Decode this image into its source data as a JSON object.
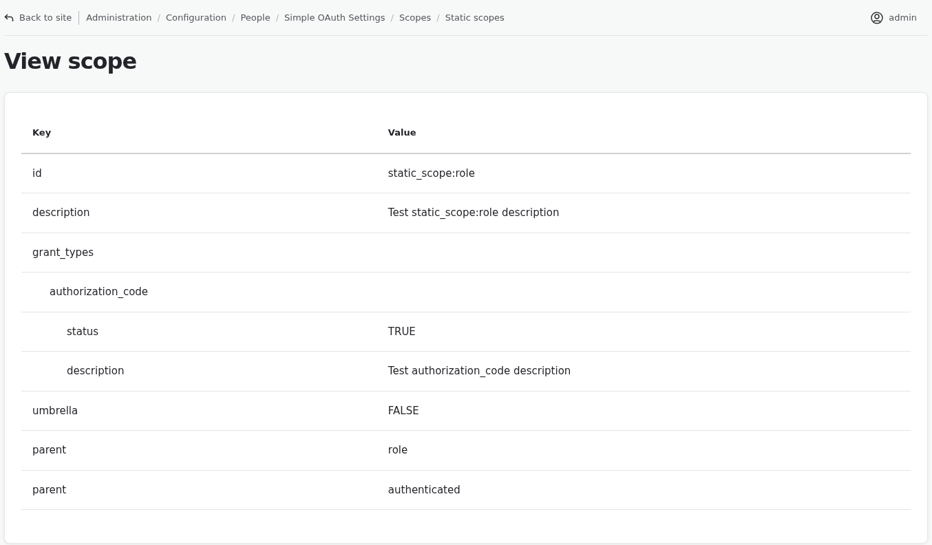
{
  "topbar": {
    "back_link": "Back to site",
    "breadcrumb": {
      "separator": "/",
      "items": [
        "Administration",
        "Configuration",
        "People",
        "Simple OAuth Settings",
        "Scopes",
        "Static scopes"
      ]
    },
    "user": "admin"
  },
  "page_title": "View scope",
  "table": {
    "columns": [
      "Key",
      "Value"
    ],
    "rows": [
      {
        "key": "id",
        "value": "static_scope:role"
      },
      {
        "key": "description",
        "value": "Test static_scope:role description"
      },
      {
        "key": "grant_types",
        "children": [
          {
            "key": "authorization_code",
            "children": [
              {
                "key": "status",
                "value": "TRUE"
              },
              {
                "key": "description",
                "value": "Test authorization_code description"
              }
            ]
          }
        ]
      },
      {
        "key": "umbrella",
        "value": "FALSE"
      },
      {
        "key": "parent",
        "value": "role"
      },
      {
        "key": "parent",
        "value": "authenticated"
      }
    ]
  }
}
